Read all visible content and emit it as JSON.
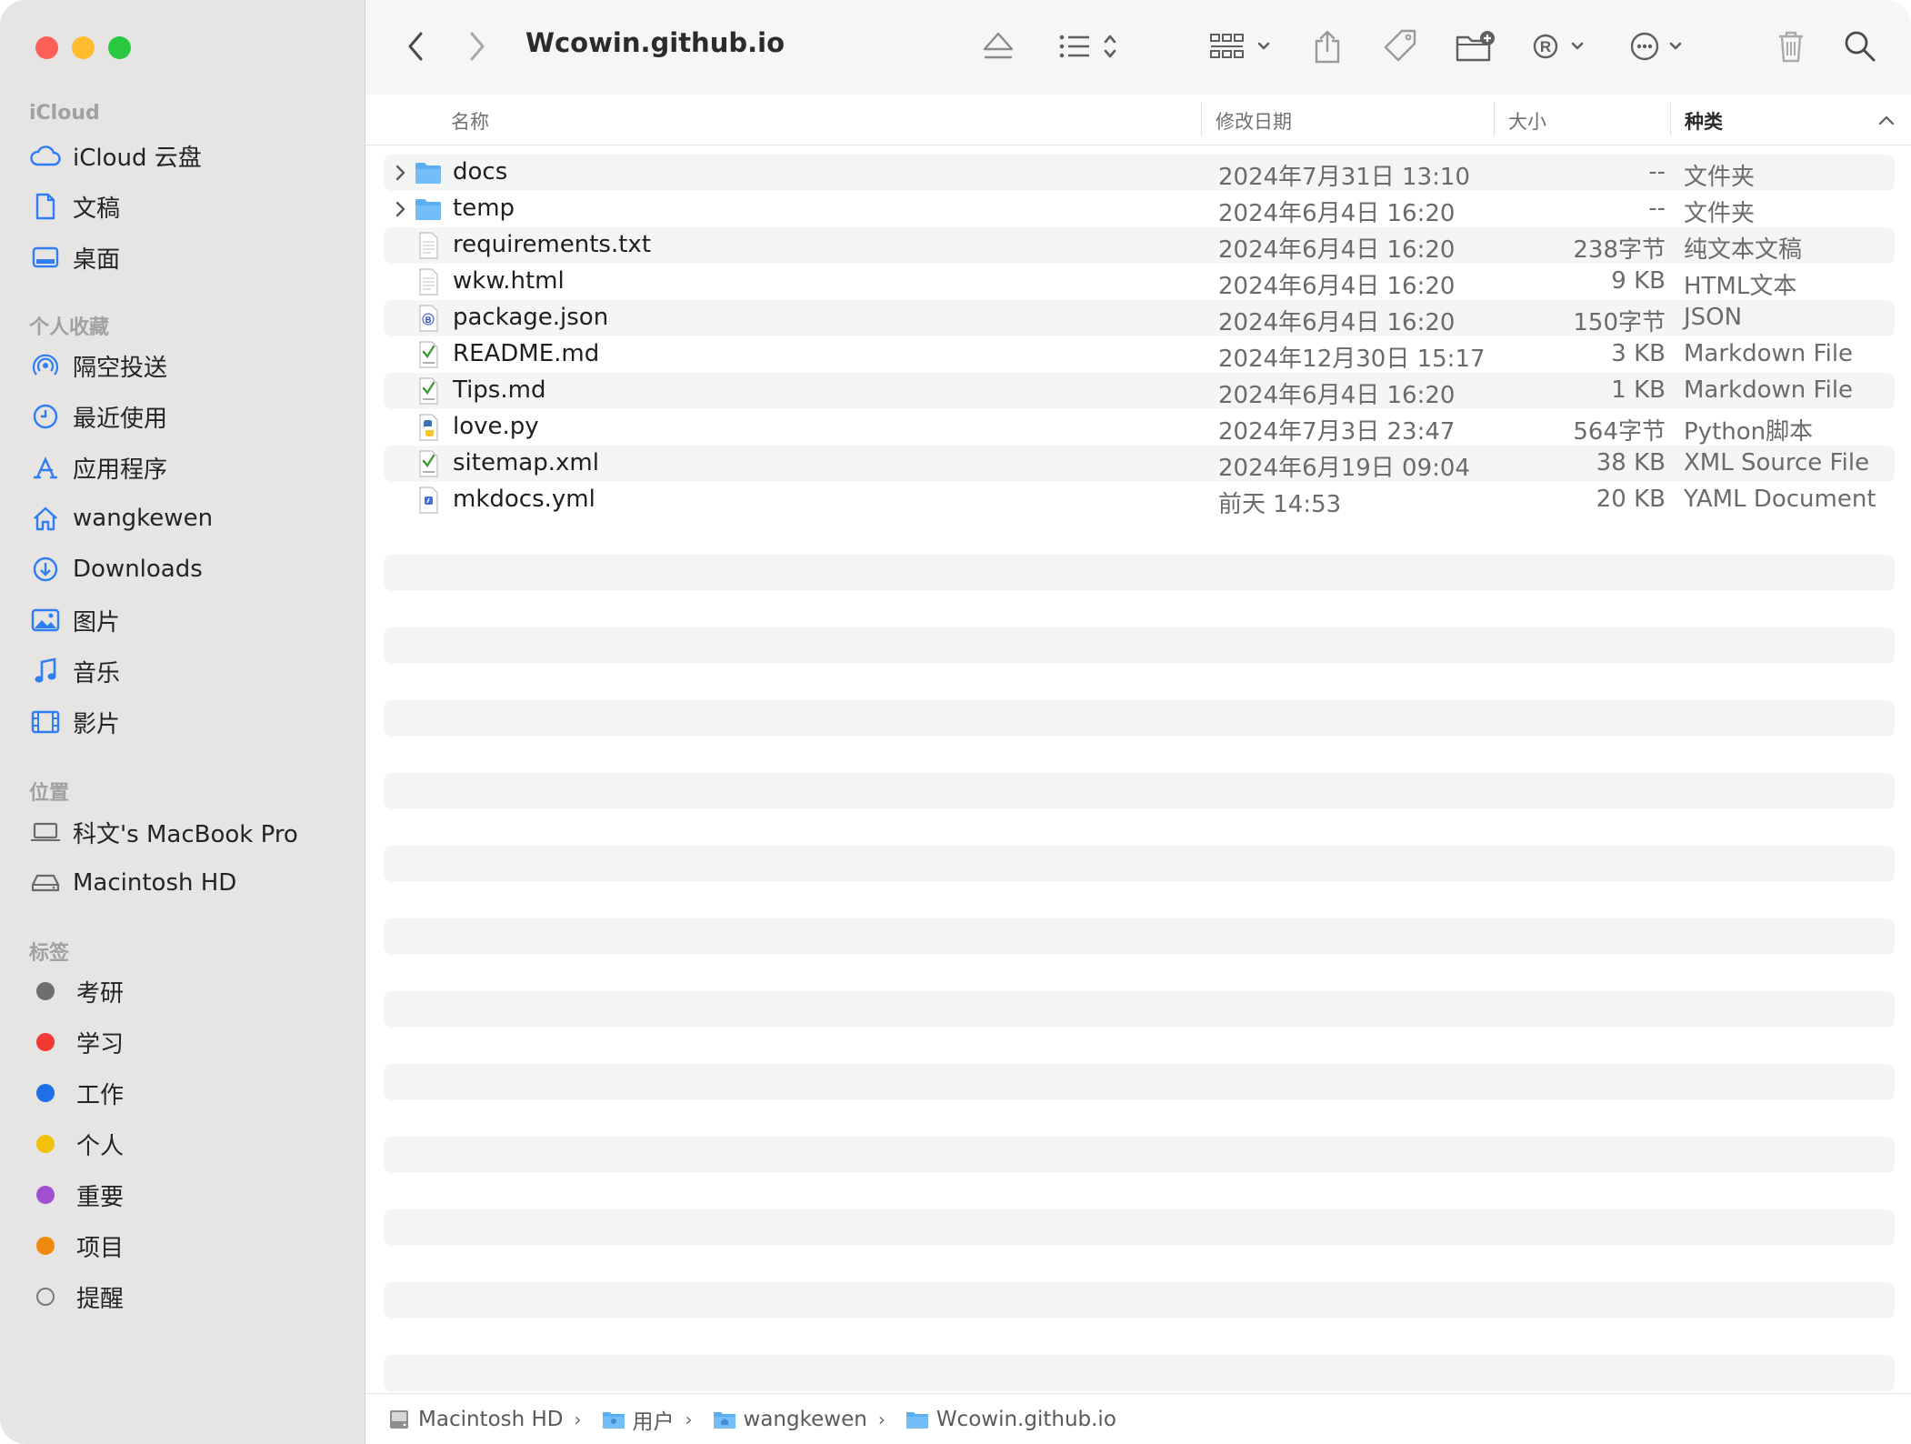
{
  "sidebar": {
    "sections": {
      "icloud": "iCloud",
      "favorites": "个人收藏",
      "locations": "位置",
      "tags": "标签"
    },
    "icloud_items": [
      {
        "label": "iCloud 云盘",
        "icon": "cloud-icon"
      },
      {
        "label": "文稿",
        "icon": "document-icon"
      },
      {
        "label": "桌面",
        "icon": "desktop-icon"
      }
    ],
    "favorite_items": [
      {
        "label": "隔空投送",
        "icon": "airdrop-icon"
      },
      {
        "label": "最近使用",
        "icon": "clock-icon"
      },
      {
        "label": "应用程序",
        "icon": "applications-icon"
      },
      {
        "label": "wangkewen",
        "icon": "home-icon"
      },
      {
        "label": "Downloads",
        "icon": "download-icon"
      },
      {
        "label": "图片",
        "icon": "photo-icon"
      },
      {
        "label": "音乐",
        "icon": "music-icon"
      },
      {
        "label": "影片",
        "icon": "film-icon"
      }
    ],
    "location_items": [
      {
        "label": "科文's MacBook Pro",
        "icon": "laptop-icon"
      },
      {
        "label": "Macintosh HD",
        "icon": "harddisk-icon"
      }
    ],
    "tag_items": [
      {
        "label": "考研",
        "color": "#6e6e70"
      },
      {
        "label": "学习",
        "color": "#f03a33"
      },
      {
        "label": "工作",
        "color": "#1e6fe8"
      },
      {
        "label": "个人",
        "color": "#f2c10c"
      },
      {
        "label": "重要",
        "color": "#a14fd1"
      },
      {
        "label": "项目",
        "color": "#f08a0e"
      },
      {
        "label": "提醒",
        "color": ""
      }
    ]
  },
  "toolbar": {
    "title": "Wcowin.github.io",
    "icons": [
      "back-icon",
      "forward-icon",
      "eject-icon",
      "list-view-icon",
      "group-icon",
      "share-icon",
      "tag-icon",
      "new-folder-icon",
      "registered-icon",
      "more-icon",
      "trash-icon",
      "search-icon"
    ]
  },
  "columns": {
    "name": "名称",
    "date": "修改日期",
    "size": "大小",
    "kind": "种类"
  },
  "files": [
    {
      "name": "docs",
      "date": "2024年7月31日 13:10",
      "size": "--",
      "kind": "文件夹",
      "type": "folder"
    },
    {
      "name": "temp",
      "date": "2024年6月4日 16:20",
      "size": "--",
      "kind": "文件夹",
      "type": "folder"
    },
    {
      "name": "requirements.txt",
      "date": "2024年6月4日 16:20",
      "size": "238字节",
      "kind": "纯文本文稿",
      "type": "txt"
    },
    {
      "name": "wkw.html",
      "date": "2024年6月4日 16:20",
      "size": "9 KB",
      "kind": "HTML文本",
      "type": "txt"
    },
    {
      "name": "package.json",
      "date": "2024年6月4日 16:20",
      "size": "150字节",
      "kind": "JSON",
      "type": "json"
    },
    {
      "name": "README.md",
      "date": "2024年12月30日 15:17",
      "size": "3 KB",
      "kind": "Markdown File",
      "type": "md"
    },
    {
      "name": "Tips.md",
      "date": "2024年6月4日 16:20",
      "size": "1 KB",
      "kind": "Markdown File",
      "type": "md"
    },
    {
      "name": "love.py",
      "date": "2024年7月3日 23:47",
      "size": "564字节",
      "kind": "Python脚本",
      "type": "py"
    },
    {
      "name": "sitemap.xml",
      "date": "2024年6月19日 09:04",
      "size": "38 KB",
      "kind": "XML Source File",
      "type": "xml"
    },
    {
      "name": "mkdocs.yml",
      "date": "前天 14:53",
      "size": "20 KB",
      "kind": "YAML Document",
      "type": "yml"
    }
  ],
  "pathbar": [
    {
      "label": "Macintosh HD",
      "icon": "harddisk-icon"
    },
    {
      "label": "用户",
      "icon": "folder-icon"
    },
    {
      "label": "wangkewen",
      "icon": "home-folder-icon"
    },
    {
      "label": "Wcowin.github.io",
      "icon": "folder-icon"
    }
  ]
}
